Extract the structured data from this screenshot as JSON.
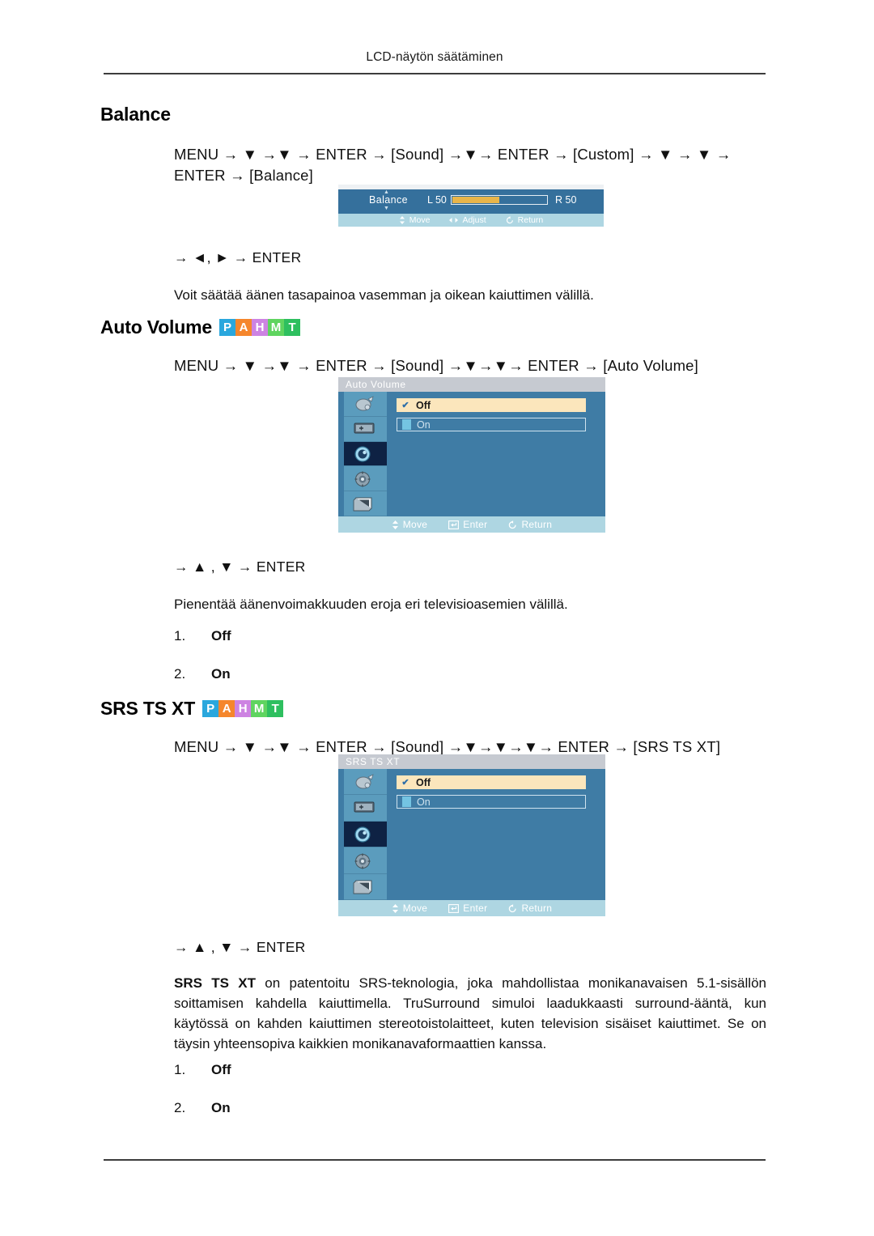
{
  "page": {
    "running_head": "LCD-näytön säätäminen"
  },
  "badge": {
    "letters": [
      "P",
      "A",
      "H",
      "M",
      "T"
    ],
    "colors": {
      "P": "#2aa7dd",
      "A": "#f5862c",
      "H": "#cd83e2",
      "M": "#5fd45f",
      "T": "#2ebf5f"
    }
  },
  "sections": {
    "balance": {
      "heading": "Balance",
      "path": "MENU → ▼ →▼ → ENTER → [Sound] →▼→ ENTER → [Custom] → ▼ → ▼ → ENTER → [Balance]",
      "keys": "→ ◄, ► → ENTER",
      "description": "Voit säätää äänen tasapainoa vasemman ja oikean kaiuttimen välillä.",
      "osd": {
        "label": "Balance",
        "left_label": "L",
        "left_value": "50",
        "right_label": "R",
        "right_value": "50",
        "fill_percent": 50,
        "statusbar": [
          {
            "icon": "updown-icon",
            "label": "Move"
          },
          {
            "icon": "leftright-icon",
            "label": "Adjust"
          },
          {
            "icon": "return-icon",
            "label": "Return"
          }
        ]
      }
    },
    "auto_volume": {
      "heading": "Auto Volume",
      "path": "MENU → ▼ →▼ → ENTER → [Sound] →▼→▼→ ENTER → [Auto Volume]",
      "keys": "→ ▲ , ▼ → ENTER",
      "description": "Pienentää äänenvoimakkuuden eroja eri televisioasemien välillä.",
      "options": [
        {
          "num": "1.",
          "label": "Off"
        },
        {
          "num": "2.",
          "label": "On"
        }
      ],
      "osd": {
        "title": "Auto Volume",
        "rail_icons": [
          "picture-icon",
          "screen-icon",
          "sound-icon",
          "setup-icon",
          "multicontrol-icon"
        ],
        "selected_rail_index": 2,
        "items": [
          {
            "label": "Off",
            "selected": true
          },
          {
            "label": "On",
            "selected": false
          }
        ],
        "statusbar": [
          {
            "icon": "updown-icon",
            "label": "Move"
          },
          {
            "icon": "enter-icon",
            "label": "Enter"
          },
          {
            "icon": "return-icon",
            "label": "Return"
          }
        ]
      }
    },
    "srs": {
      "heading": "SRS TS XT",
      "path": "MENU → ▼ →▼ → ENTER → [Sound] →▼→▼→▼→ ENTER → [SRS TS XT]",
      "keys": "→ ▲ , ▼ → ENTER",
      "description_bold": "SRS TS XT",
      "description": " on patentoitu SRS-teknologia, joka mahdollistaa monikanavaisen 5.1-sisällön soittamisen kahdella kaiuttimella. TruSurround simuloi laadukkaasti surround-ääntä, kun käytössä on kahden kaiuttimen stereotoistolaitteet, kuten television sisäiset kaiuttimet. Se on täysin yhteensopiva kaikkien monikanavaformaattien kanssa.",
      "options": [
        {
          "num": "1.",
          "label": "Off"
        },
        {
          "num": "2.",
          "label": "On"
        }
      ],
      "osd": {
        "title": "SRS TS XT",
        "rail_icons": [
          "picture-icon",
          "screen-icon",
          "sound-icon",
          "setup-icon",
          "multicontrol-icon"
        ],
        "selected_rail_index": 2,
        "items": [
          {
            "label": "Off",
            "selected": true
          },
          {
            "label": "On",
            "selected": false
          }
        ],
        "statusbar": [
          {
            "icon": "updown-icon",
            "label": "Move"
          },
          {
            "icon": "enter-icon",
            "label": "Enter"
          },
          {
            "icon": "return-icon",
            "label": "Return"
          }
        ]
      }
    }
  }
}
